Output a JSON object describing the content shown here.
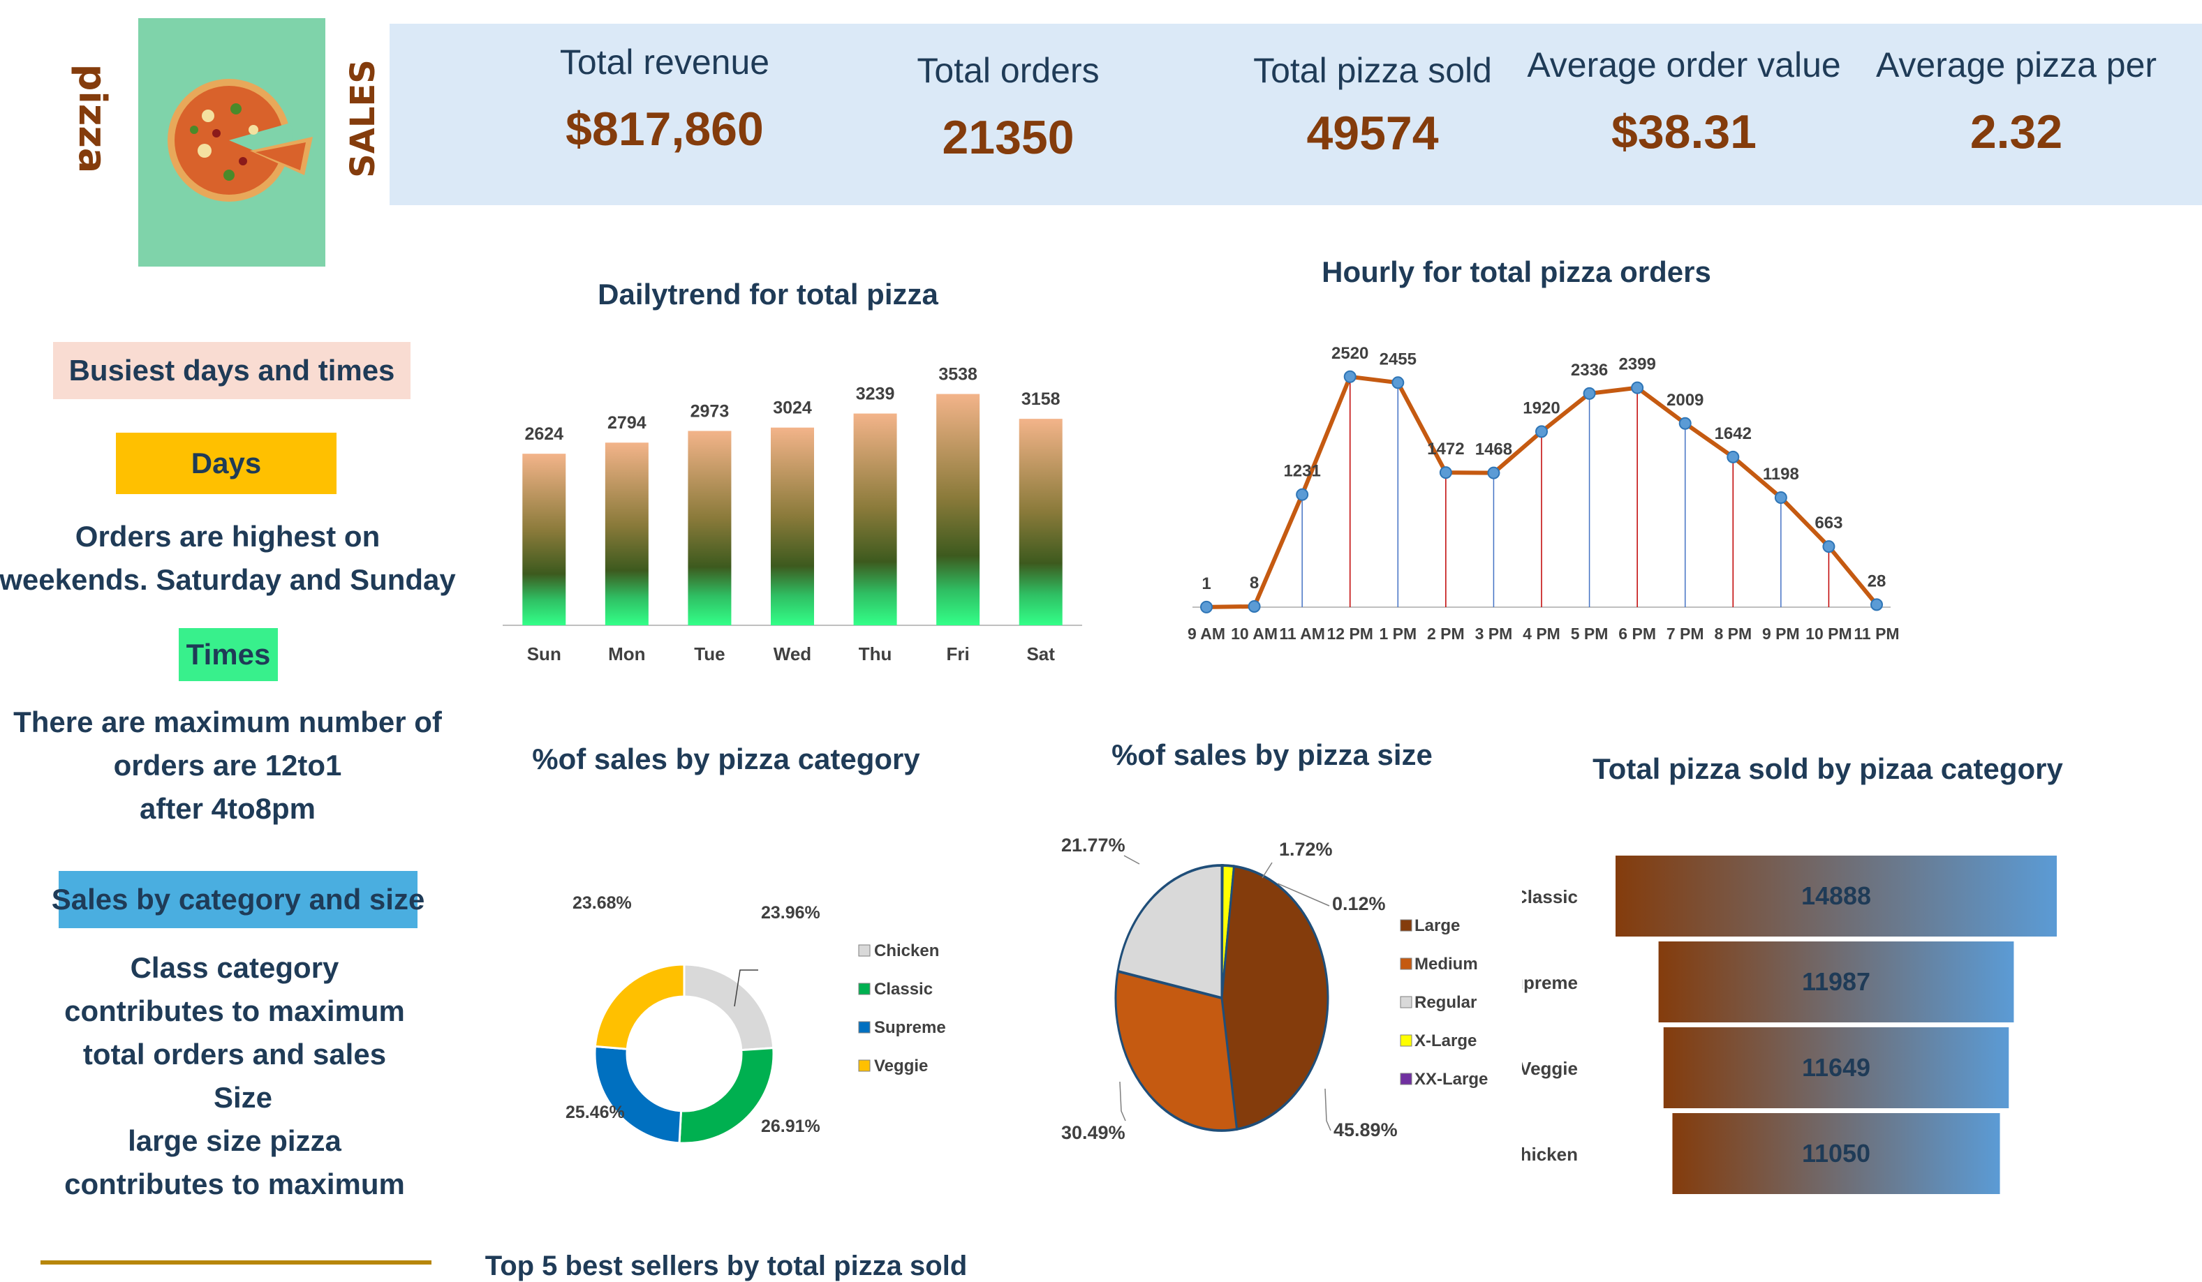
{
  "brand": {
    "word1": "pizza",
    "word2": "SALES"
  },
  "kpis": [
    {
      "label": "Total revenue",
      "value": "$817,860"
    },
    {
      "label": "Total orders",
      "value": "21350"
    },
    {
      "label": "Total pizza sold",
      "value": "49574"
    },
    {
      "label": "Average order value",
      "value": "$38.31"
    },
    {
      "label": "Average pizza per",
      "value": "2.32"
    }
  ],
  "sidebar": {
    "heading1": "Busiest days and times",
    "days_label": "Days",
    "days_text": [
      "Orders are highest on",
      "weekends. Saturday and Sunday"
    ],
    "times_label": "Times",
    "times_text": [
      "There are maximum number of",
      "orders are 12to1",
      "after 4to8pm"
    ],
    "heading2": "Sales by category and size",
    "cat_text": [
      "Class category",
      "contributes to maximum",
      "total orders and sales",
      "Size",
      "large size pizza",
      "contributes to maximum"
    ]
  },
  "bottom_title": "Top 5 best sellers by total pizza sold",
  "colors": {
    "kpi_value": "#843c0c",
    "text": "#1f3b57",
    "line": "#c55a11",
    "marker": "#5b9bd5"
  },
  "chart_data": [
    {
      "type": "bar",
      "title": "Dailytrend for total pizza",
      "categories": [
        "Sun",
        "Mon",
        "Tue",
        "Wed",
        "Thu",
        "Fri",
        "Sat"
      ],
      "values": [
        2624,
        2794,
        2973,
        3024,
        3239,
        3538,
        3158
      ],
      "ylim": [
        0,
        3800
      ],
      "grid": false
    },
    {
      "type": "line",
      "title": "Hourly for total pizza orders",
      "x": [
        "9 AM",
        "10 AM",
        "11 AM",
        "12 PM",
        "1 PM",
        "2 PM",
        "3 PM",
        "4 PM",
        "5 PM",
        "6 PM",
        "7 PM",
        "8 PM",
        "9 PM",
        "10 PM",
        "11 PM"
      ],
      "values": [
        1,
        8,
        1231,
        2520,
        2455,
        1472,
        1468,
        1920,
        2336,
        2399,
        2009,
        1642,
        1198,
        663,
        28
      ],
      "ylim": [
        0,
        2900
      ],
      "grid": false
    },
    {
      "type": "pie",
      "title": "%of sales by pizza category",
      "style": "donut",
      "labels": [
        "Chicken",
        "Classic",
        "Supreme",
        "Veggie"
      ],
      "values": [
        23.96,
        26.91,
        25.46,
        23.68
      ],
      "value_labels": [
        "23.96%",
        "26.91%",
        "25.46%",
        "23.68%"
      ],
      "colors": [
        "#d9d9d9",
        "#00b050",
        "#0070c0",
        "#ffc000"
      ],
      "legend": "right"
    },
    {
      "type": "pie",
      "title": "%of sales by pizza size",
      "labels": [
        "Large",
        "Medium",
        "Regular",
        "X-Large",
        "XX-Large"
      ],
      "values": [
        45.89,
        30.49,
        21.77,
        1.72,
        0.12
      ],
      "value_labels": [
        "45.89%",
        "30.49%",
        "21.77%",
        "1.72%",
        "0.12%"
      ],
      "colors": [
        "#843c0c",
        "#c55a11",
        "#d9d9d9",
        "#ffff00",
        "#7030a0"
      ],
      "legend": "right"
    },
    {
      "type": "bar",
      "orientation": "horizontal",
      "style": "funnel",
      "title": "Total pizza sold by pizaa category",
      "categories": [
        "Classic",
        "Supreme",
        "Veggie",
        "Chicken"
      ],
      "values": [
        14888,
        11987,
        11649,
        11050
      ]
    }
  ]
}
